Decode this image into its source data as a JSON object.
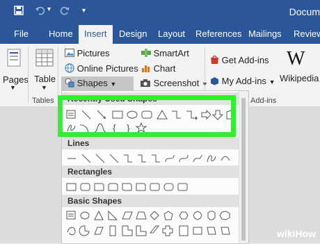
{
  "window": {
    "title": "Docum"
  },
  "quick_access": {
    "save_icon": "save-icon",
    "undo_icon": "undo-icon",
    "redo_icon": "redo-icon",
    "customize_icon": "customize-qat-icon"
  },
  "tabs": [
    {
      "label": "File"
    },
    {
      "label": "Home"
    },
    {
      "label": "Insert",
      "active": true
    },
    {
      "label": "Design"
    },
    {
      "label": "Layout"
    },
    {
      "label": "References"
    },
    {
      "label": "Mailings"
    },
    {
      "label": "Review"
    }
  ],
  "ribbon": {
    "pages": "Pages",
    "table": "Table",
    "tables_group": "Tables",
    "pictures": "Pictures",
    "online_pictures": "Online Pictures",
    "shapes": "Shapes",
    "smartart": "SmartArt",
    "chart": "Chart",
    "screenshot": "Screenshot",
    "get_addins": "Get Add-ins",
    "my_addins": "My Add-ins",
    "addins_group": "Add-ins",
    "wikipedia": "Wikipedia"
  },
  "shapes_panel": {
    "recently_used": "Recently Used Shapes",
    "lines": "Lines",
    "rectangles": "Rectangles",
    "basic_shapes": "Basic Shapes"
  },
  "watermark": {
    "wiki": "wiki",
    "how": "How"
  },
  "colors": {
    "word_blue": "#2b579a",
    "highlight_green": "#2ff12f"
  }
}
